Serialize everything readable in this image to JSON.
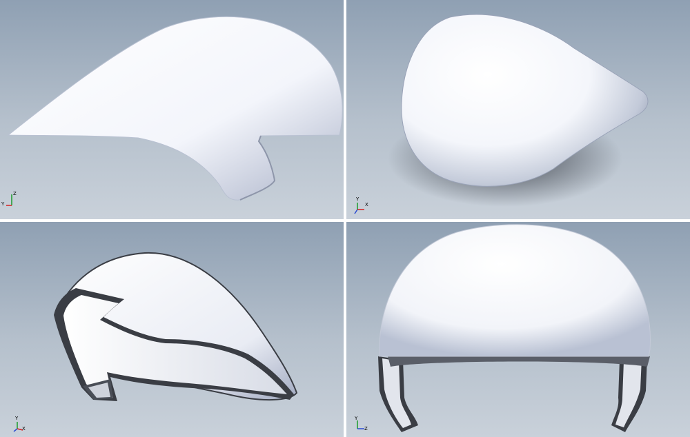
{
  "viewports": [
    {
      "id": "top-left",
      "view": "side",
      "triad": {
        "x_label": "Y",
        "y_label": "Z"
      }
    },
    {
      "id": "top-right",
      "view": "top",
      "triad": {
        "x_label": "X",
        "y_label": "Y"
      }
    },
    {
      "id": "bottom-left",
      "view": "isometric-underside",
      "triad": {
        "x_label": "X",
        "y_label": "Y"
      }
    },
    {
      "id": "bottom-right",
      "view": "front",
      "triad": {
        "x_label": "Z",
        "y_label": "Y"
      }
    }
  ],
  "colors": {
    "background_top": "#8fa0b3",
    "background_bottom": "#c9d1da",
    "model_surface": "#ffffff",
    "model_shade": "#9da6bd",
    "edge_dark": "#3a3d44",
    "triad_x": "#d62020",
    "triad_y": "#1a9c2a",
    "triad_z": "#2a4bd0"
  }
}
